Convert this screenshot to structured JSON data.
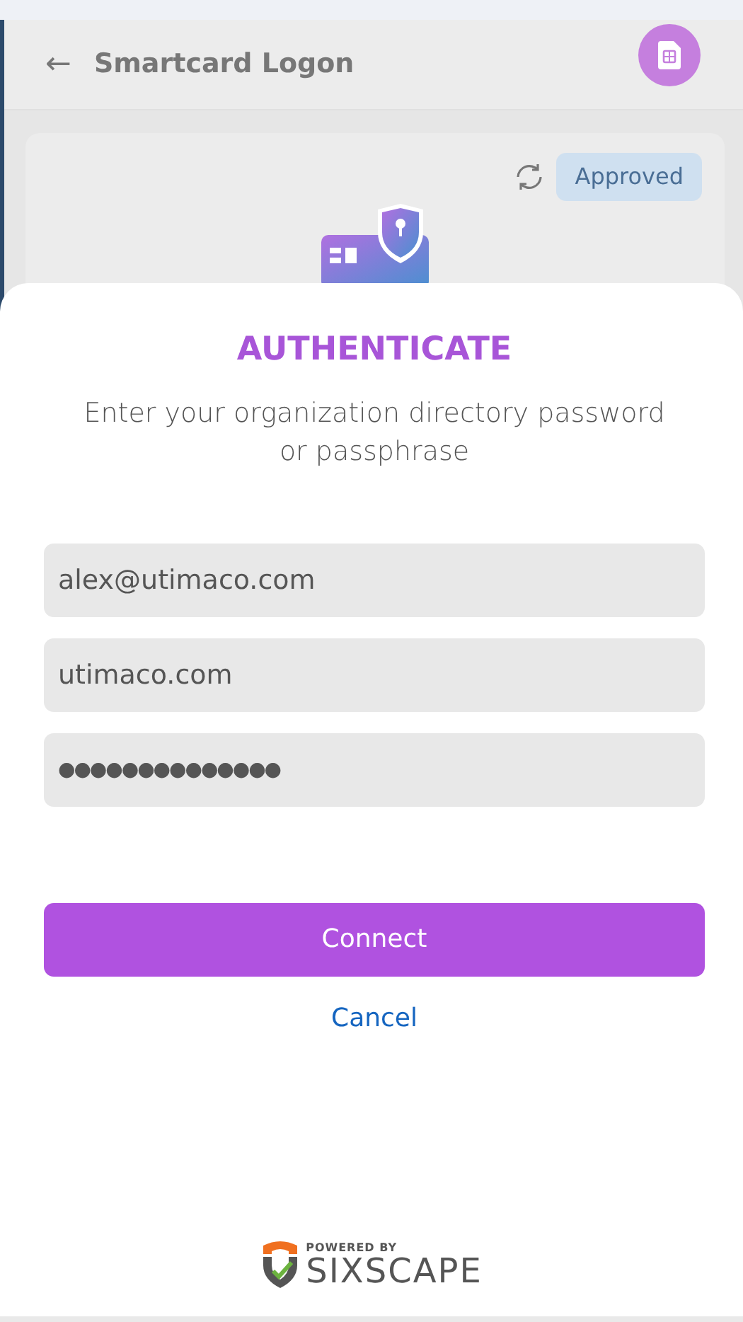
{
  "header": {
    "back": "←",
    "title": "Smartcard Logon"
  },
  "card": {
    "status": "Approved"
  },
  "dialog": {
    "title": "AUTHENTICATE",
    "subtitle": "Enter your organization directory password or passphrase",
    "fields": [
      {
        "kind": "text",
        "value": "alex@utimaco.com"
      },
      {
        "kind": "text",
        "value": "utimaco.com"
      },
      {
        "kind": "password",
        "value": "●●●●●●●●●●●●●●"
      }
    ],
    "primary_button": "Connect",
    "cancel_link": "Cancel",
    "footer": {
      "tagline": "POWERED BY",
      "brand": "SIXSCAPE"
    }
  }
}
